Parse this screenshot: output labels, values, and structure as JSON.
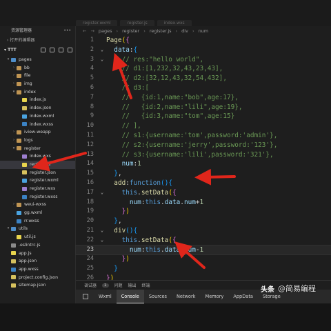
{
  "tabs": [
    "register.wxml",
    "register.js",
    "index.wxs"
  ],
  "sidebar": {
    "title": "资源管理器",
    "open_editors": "打开的编辑器",
    "project": "TTT",
    "tree": [
      {
        "label": "pages",
        "kind": "folder-blue",
        "indent": 1,
        "chev": "▾"
      },
      {
        "label": "bb",
        "kind": "folder",
        "indent": 2,
        "chev": "›"
      },
      {
        "label": "file",
        "kind": "folder",
        "indent": 2,
        "chev": "›"
      },
      {
        "label": "img",
        "kind": "folder",
        "indent": 2,
        "chev": "›"
      },
      {
        "label": "index",
        "kind": "folder",
        "indent": 2,
        "chev": "▾"
      },
      {
        "label": "index.js",
        "kind": "js",
        "indent": 3,
        "chev": ""
      },
      {
        "label": "index.json",
        "kind": "json",
        "indent": 3,
        "chev": ""
      },
      {
        "label": "index.wxml",
        "kind": "wxml",
        "indent": 3,
        "chev": ""
      },
      {
        "label": "index.wxss",
        "kind": "wxss",
        "indent": 3,
        "chev": ""
      },
      {
        "label": "iview-weapp",
        "kind": "folder",
        "indent": 2,
        "chev": "›"
      },
      {
        "label": "logs",
        "kind": "folder",
        "indent": 2,
        "chev": "›"
      },
      {
        "label": "register",
        "kind": "folder",
        "indent": 2,
        "chev": "▾"
      },
      {
        "label": "index.wxs",
        "kind": "wxs",
        "indent": 3,
        "chev": ""
      },
      {
        "label": "register.js",
        "kind": "js",
        "indent": 3,
        "chev": "",
        "selected": true
      },
      {
        "label": "register.json",
        "kind": "json",
        "indent": 3,
        "chev": ""
      },
      {
        "label": "register.wxml",
        "kind": "wxml",
        "indent": 3,
        "chev": ""
      },
      {
        "label": "register.wxs",
        "kind": "wxs",
        "indent": 3,
        "chev": ""
      },
      {
        "label": "register.wxss",
        "kind": "wxss",
        "indent": 3,
        "chev": ""
      },
      {
        "label": "weui-wxss",
        "kind": "folder",
        "indent": 2,
        "chev": "›"
      },
      {
        "label": "gg.wxml",
        "kind": "wxml",
        "indent": 2,
        "chev": ""
      },
      {
        "label": "rr.wxss",
        "kind": "wxss",
        "indent": 2,
        "chev": ""
      },
      {
        "label": "utils",
        "kind": "folder-blue",
        "indent": 1,
        "chev": "▾"
      },
      {
        "label": "util.js",
        "kind": "js",
        "indent": 2,
        "chev": ""
      },
      {
        "label": ".eslintrc.js",
        "kind": "doc",
        "indent": 1,
        "chev": ""
      },
      {
        "label": "app.js",
        "kind": "js",
        "indent": 1,
        "chev": ""
      },
      {
        "label": "app.json",
        "kind": "json",
        "indent": 1,
        "chev": ""
      },
      {
        "label": "app.wxss",
        "kind": "wxss",
        "indent": 1,
        "chev": ""
      },
      {
        "label": "project.config.json",
        "kind": "json",
        "indent": 1,
        "chev": ""
      },
      {
        "label": "sitemap.json",
        "kind": "json",
        "indent": 1,
        "chev": ""
      }
    ]
  },
  "breadcrumb": [
    "pages",
    "register",
    "register.js",
    "div",
    "num"
  ],
  "code": [
    {
      "n": "1",
      "fold": "",
      "tokens": [
        [
          "c-func",
          "Page"
        ],
        [
          "c-brace",
          "("
        ],
        [
          "c-brace2",
          "{"
        ]
      ]
    },
    {
      "n": "2",
      "fold": "⌄",
      "tokens": [
        [
          "c-plain",
          "  "
        ],
        [
          "c-key",
          "data"
        ],
        [
          "c-plain",
          ":"
        ],
        [
          "c-brace3",
          "{"
        ]
      ]
    },
    {
      "n": "3",
      "fold": "⌄",
      "tokens": [
        [
          "c-cmt",
          "    // res:\"hello world\","
        ]
      ]
    },
    {
      "n": "4",
      "fold": "",
      "tokens": [
        [
          "c-cmt",
          "    // d1:[1,232,32,43,23,43],"
        ]
      ]
    },
    {
      "n": "5",
      "fold": "",
      "tokens": [
        [
          "c-cmt",
          "    // d2:[32,12,43,32,54,432],"
        ]
      ]
    },
    {
      "n": "6",
      "fold": "",
      "tokens": [
        [
          "c-cmt",
          "    // d3:["
        ]
      ]
    },
    {
      "n": "7",
      "fold": "",
      "tokens": [
        [
          "c-cmt",
          "    //   {id:1,name:\"bob\",age:17},"
        ]
      ]
    },
    {
      "n": "8",
      "fold": "",
      "tokens": [
        [
          "c-cmt",
          "    //   {id:2,name:\"lili\",age:19},"
        ]
      ]
    },
    {
      "n": "9",
      "fold": "",
      "tokens": [
        [
          "c-cmt",
          "    //   {id:3,name:\"tom\",age:15}"
        ]
      ]
    },
    {
      "n": "10",
      "fold": "",
      "tokens": [
        [
          "c-cmt",
          "    // ],"
        ]
      ]
    },
    {
      "n": "11",
      "fold": "",
      "tokens": [
        [
          "c-cmt",
          "    // s1:{username:'tom',password:'admin'},"
        ]
      ]
    },
    {
      "n": "12",
      "fold": "",
      "tokens": [
        [
          "c-cmt",
          "    // s2:{username:'jerry',password:'123'},"
        ]
      ]
    },
    {
      "n": "13",
      "fold": "",
      "tokens": [
        [
          "c-cmt",
          "    // s3:{username:'lili',password:'321'},"
        ]
      ]
    },
    {
      "n": "14",
      "fold": "",
      "tokens": [
        [
          "c-plain",
          "    "
        ],
        [
          "c-key",
          "num"
        ],
        [
          "c-plain",
          ":"
        ],
        [
          "c-num",
          "1"
        ]
      ]
    },
    {
      "n": "15",
      "fold": "",
      "tokens": [
        [
          "c-plain",
          "  "
        ],
        [
          "c-brace3",
          "}"
        ],
        [
          "c-plain",
          ","
        ]
      ]
    },
    {
      "n": "16",
      "fold": "",
      "tokens": [
        [
          "c-plain",
          "  "
        ],
        [
          "c-func",
          "add"
        ],
        [
          "c-plain",
          ":"
        ],
        [
          "c-kw",
          "function"
        ],
        [
          "c-brace3",
          "()"
        ],
        [
          "c-brace3",
          "{"
        ]
      ]
    },
    {
      "n": "17",
      "fold": "⌄",
      "tokens": [
        [
          "c-plain",
          "    "
        ],
        [
          "c-kw",
          "this"
        ],
        [
          "c-plain",
          "."
        ],
        [
          "c-func",
          "setData"
        ],
        [
          "c-brace",
          "("
        ],
        [
          "c-brace2",
          "{"
        ]
      ]
    },
    {
      "n": "18",
      "fold": "",
      "tokens": [
        [
          "c-plain",
          "      "
        ],
        [
          "c-key",
          "num"
        ],
        [
          "c-plain",
          ":"
        ],
        [
          "c-kw",
          "this"
        ],
        [
          "c-plain",
          "."
        ],
        [
          "c-key",
          "data"
        ],
        [
          "c-plain",
          "."
        ],
        [
          "c-key",
          "num"
        ],
        [
          "c-plain",
          "+"
        ],
        [
          "c-num",
          "1"
        ]
      ]
    },
    {
      "n": "19",
      "fold": "",
      "tokens": [
        [
          "c-plain",
          "    "
        ],
        [
          "c-brace2",
          "}"
        ],
        [
          "c-brace",
          ")"
        ]
      ]
    },
    {
      "n": "20",
      "fold": "",
      "tokens": [
        [
          "c-plain",
          "  "
        ],
        [
          "c-brace3",
          "}"
        ],
        [
          "c-plain",
          ","
        ]
      ]
    },
    {
      "n": "21",
      "fold": "⌄",
      "tokens": [
        [
          "c-plain",
          "  "
        ],
        [
          "c-func",
          "div"
        ],
        [
          "c-brace3",
          "()"
        ],
        [
          "c-brace3",
          "{"
        ]
      ]
    },
    {
      "n": "22",
      "fold": "⌄",
      "tokens": [
        [
          "c-plain",
          "    "
        ],
        [
          "c-kw",
          "this"
        ],
        [
          "c-plain",
          "."
        ],
        [
          "c-func",
          "setData"
        ],
        [
          "c-brace",
          "("
        ],
        [
          "c-brace2",
          "{"
        ]
      ]
    },
    {
      "n": "23",
      "fold": "",
      "current": true,
      "tokens": [
        [
          "c-plain",
          "      "
        ],
        [
          "c-key",
          "num"
        ],
        [
          "c-plain",
          ":"
        ],
        [
          "c-kw",
          "this"
        ],
        [
          "c-plain",
          "."
        ],
        [
          "c-key",
          "data"
        ],
        [
          "c-plain",
          "."
        ],
        [
          "c-key",
          "num"
        ],
        [
          "c-plain",
          "-"
        ],
        [
          "c-num",
          "1"
        ]
      ]
    },
    {
      "n": "24",
      "fold": "",
      "tokens": [
        [
          "c-plain",
          "    "
        ],
        [
          "c-brace2",
          "}"
        ],
        [
          "c-brace",
          ")"
        ]
      ]
    },
    {
      "n": "25",
      "fold": "",
      "tokens": [
        [
          "c-plain",
          "  "
        ],
        [
          "c-brace3",
          "}"
        ]
      ]
    },
    {
      "n": "26",
      "fold": "",
      "tokens": [
        [
          "c-brace2",
          "}"
        ],
        [
          "c-brace",
          ")"
        ]
      ]
    }
  ],
  "panel": {
    "tabs": [
      "调试器",
      "1",
      "问题",
      "输出",
      "终端"
    ],
    "devtools": [
      "Wxml",
      "Console",
      "Sources",
      "Network",
      "Memory",
      "AppData",
      "Storage"
    ],
    "active_devtool": "Console"
  },
  "watermark": {
    "logo": "头条",
    "text": "@简易编程"
  },
  "colors": {
    "arrow": "#e0261b",
    "selection": "#37373d"
  }
}
